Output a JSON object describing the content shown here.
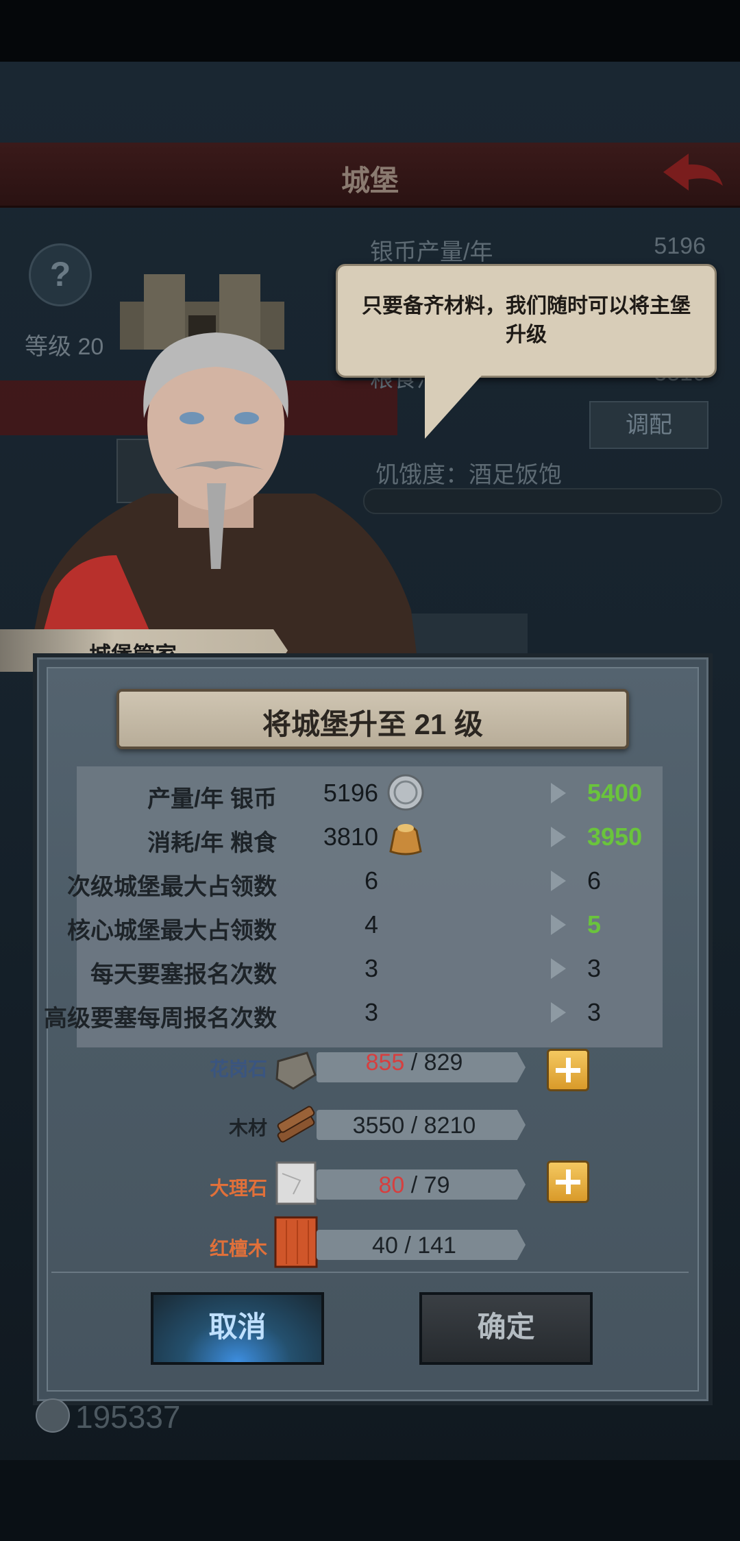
{
  "background_screen": {
    "title": "城堡",
    "help_icon": "?",
    "level_text": "等级 20",
    "rows": [
      {
        "label": "银币产量/年",
        "value": "5196"
      },
      {
        "label": "粮食消",
        "value": "3810"
      }
    ],
    "adjust_button": "调配",
    "hunger_text": "饥饿度：酒足饭饱",
    "coins": "195337"
  },
  "speech": {
    "text": "只要备齐材料，我们随时可以将主堡升级"
  },
  "npc": {
    "name": "城堡管家"
  },
  "dialog": {
    "title": "将城堡升至 21 级",
    "stats": [
      {
        "label": "产量/年 银币",
        "icon": "silver-coin-icon",
        "current": "5196",
        "next": "5400",
        "improved": true
      },
      {
        "label": "消耗/年 粮食",
        "icon": "grain-sack-icon",
        "current": "3810",
        "next": "3950",
        "improved": true
      },
      {
        "label": "次级城堡最大占领数",
        "icon": "",
        "current": "6",
        "next": "6",
        "improved": false
      },
      {
        "label": "核心城堡最大占领数",
        "icon": "",
        "current": "4",
        "next": "5",
        "improved": true
      },
      {
        "label": "每天要塞报名次数",
        "icon": "",
        "current": "3",
        "next": "3",
        "improved": false
      },
      {
        "label": "高级要塞每周报名次数",
        "icon": "",
        "current": "3",
        "next": "3",
        "improved": false
      }
    ],
    "materials": [
      {
        "name": "花岗石",
        "icon": "granite-icon",
        "have": "855",
        "need": "829",
        "rare": false,
        "short": true
      },
      {
        "name": "木材",
        "icon": "wood-icon",
        "have": "3550",
        "need": "8210",
        "rare": false,
        "short": false
      },
      {
        "name": "大理石",
        "icon": "marble-icon",
        "have": "80",
        "need": "79",
        "rare": true,
        "short": true
      },
      {
        "name": "红檀木",
        "icon": "redwood-icon",
        "have": "40",
        "need": "141",
        "rare": true,
        "short": false
      }
    ],
    "separator": "/",
    "cancel_label": "取消",
    "confirm_label": "确定"
  },
  "colors": {
    "improved_green": "#6ac43c",
    "rare_orange": "#e0703a",
    "short_red": "#d63f3f",
    "cancel_blue": "#3d8ee0"
  }
}
